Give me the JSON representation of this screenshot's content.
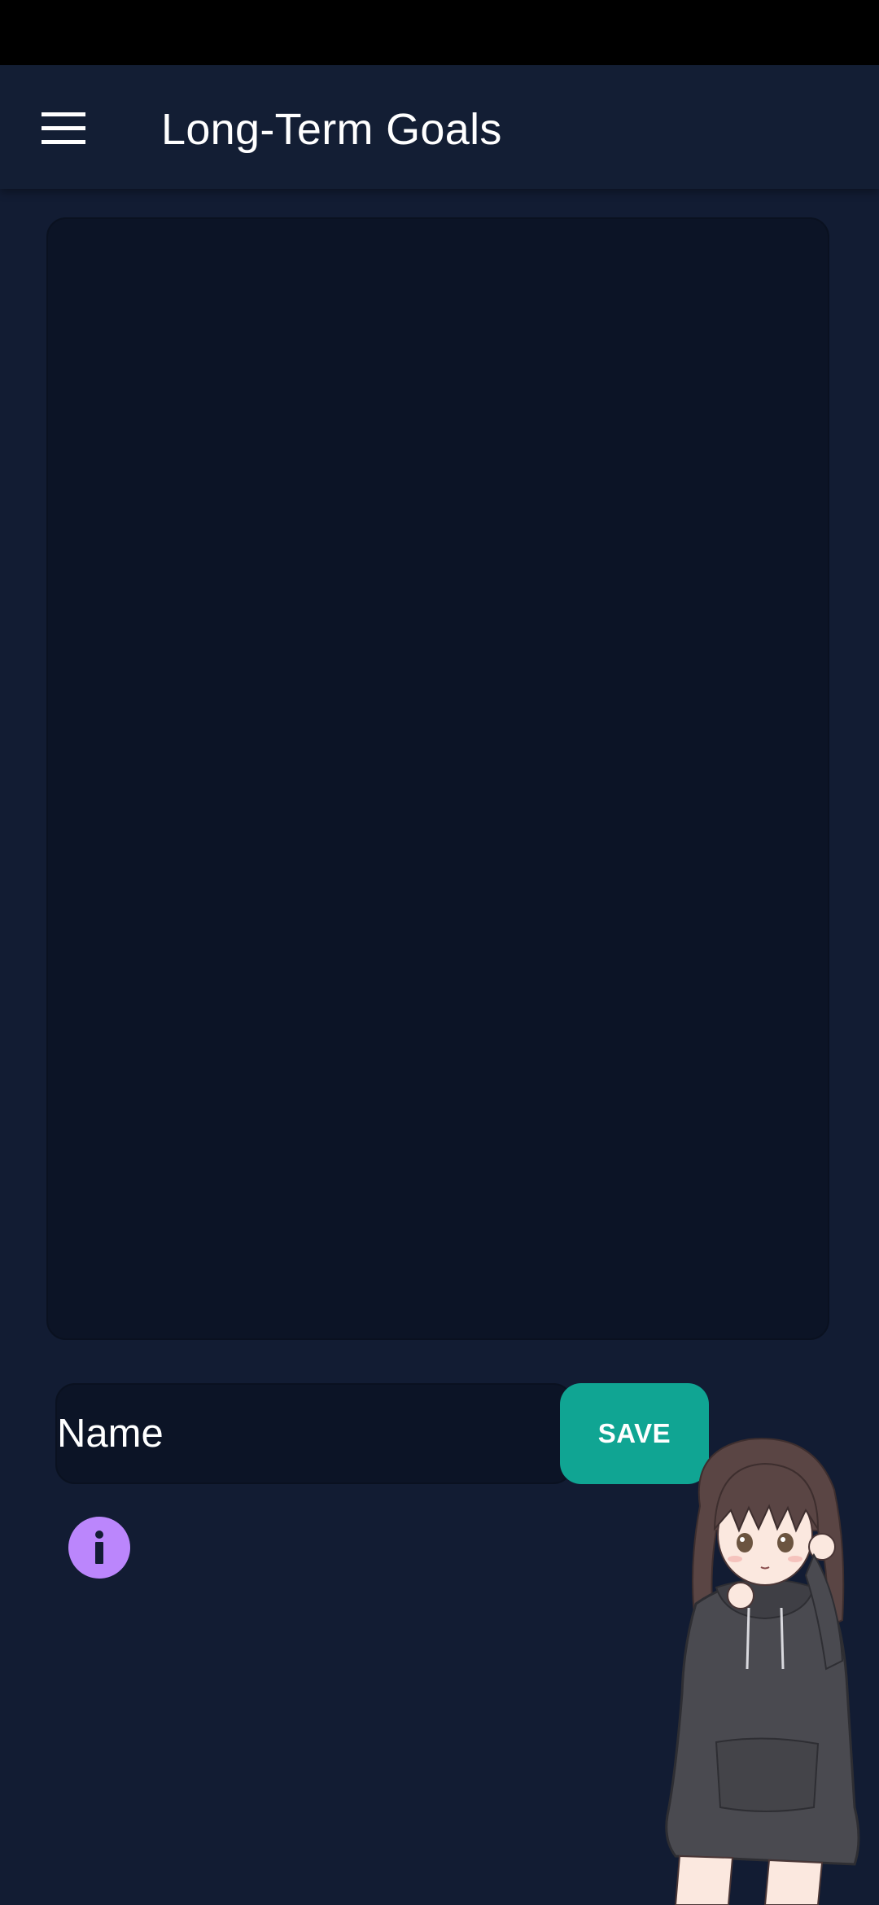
{
  "app_bar": {
    "title": "Long-Term Goals",
    "menu_icon": "hamburger-menu-icon"
  },
  "editor": {
    "content": ""
  },
  "form": {
    "name_placeholder": "Name",
    "name_value": "",
    "save_label": "SAVE"
  },
  "info_button": {
    "icon": "info-icon"
  },
  "mascot": {
    "description_icon": "anime-girl-hoodie-illustration"
  },
  "colors": {
    "background": "#121c33",
    "app_bar": "#131e34",
    "card": "#0c1426",
    "accent_save": "#10a593",
    "accent_info": "#bb86fc"
  }
}
